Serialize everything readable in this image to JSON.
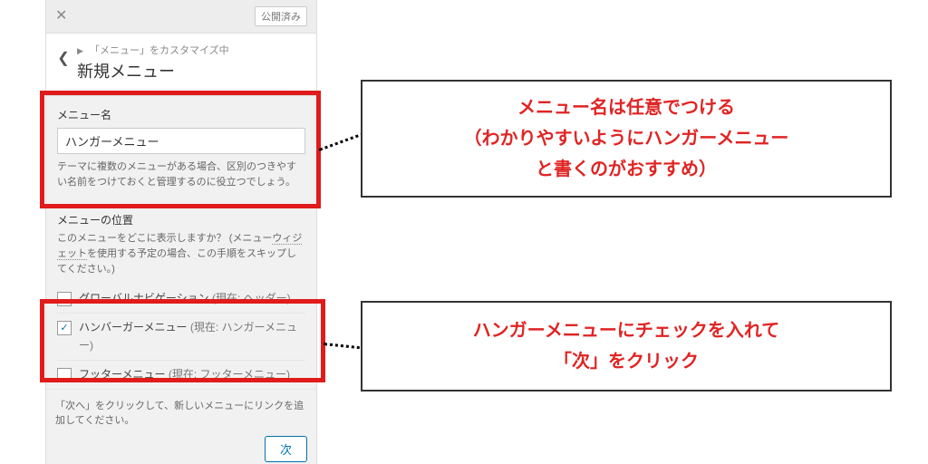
{
  "topbar": {
    "published_pill": "公開済み"
  },
  "header": {
    "breadcrumb": "「メニュー」をカスタマイズ中",
    "title": "新規メニュー"
  },
  "menu_name": {
    "label": "メニュー名",
    "value": "ハンガーメニュー",
    "help": "テーマに複数のメニューがある場合、区別のつきやすい名前をつけておくと管理するのに役立つでしょう。"
  },
  "location": {
    "heading": "メニューの位置",
    "help_pre": "このメニューをどこに表示しますか？ (メニュー",
    "help_link": "ウィジェット",
    "help_post": "を使用する予定の場合、この手順をスキップしてください。)",
    "items": [
      {
        "label": "グローバルナビゲーション",
        "current": " (現在: ヘッダー)",
        "checked": false
      },
      {
        "label": "ハンバーガーメニュー",
        "current": " (現在: ハンガーメニュー)",
        "checked": true
      },
      {
        "label": "フッターメニュー",
        "current": " (現在: フッターメニュー)",
        "checked": false
      }
    ]
  },
  "next": {
    "help": "「次へ」をクリックして、新しいメニューにリンクを追加してください。",
    "button": "次"
  },
  "callouts": {
    "c1_l1": "メニュー名は任意でつける",
    "c1_l2": "（わかりやすいようにハンガーメニュー",
    "c1_l3": "と書くのがおすすめ）",
    "c2_l1": "ハンガーメニューにチェックを入れて",
    "c2_l2": "「次」をクリック"
  }
}
